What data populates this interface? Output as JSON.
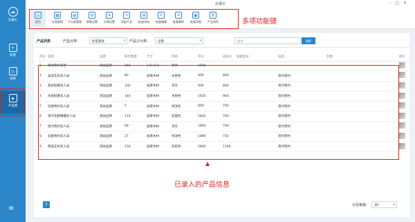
{
  "app": {
    "title": "云报价",
    "logo_label": "云报价"
  },
  "sidebar": {
    "items": [
      {
        "label": "新建",
        "icon": "new-icon"
      },
      {
        "label": "项目",
        "icon": "project-icon"
      },
      {
        "label": "产品库",
        "icon": "product-icon",
        "active": true
      }
    ]
  },
  "toolbar": {
    "items": [
      {
        "label": "首页"
      },
      {
        "label": "分类管理"
      },
      {
        "label": "子分类管理"
      },
      {
        "label": "参数设置"
      },
      {
        "label": "价格设置"
      },
      {
        "label": "添加产品"
      },
      {
        "label": "批量添加"
      },
      {
        "label": "批量编辑"
      },
      {
        "label": "批量删除"
      },
      {
        "label": "批量添图"
      },
      {
        "label": "产品排序"
      }
    ]
  },
  "annotations": {
    "toolbar": "多项功能键",
    "table": "已录入的产品信息",
    "arrow": "▲"
  },
  "filter": {
    "list_title": "产品列表",
    "category_label": "产品分类：",
    "category_value": "卧室家具",
    "subcategory_label": "产品子分类：",
    "subcategory_value": "全部",
    "search_placeholder": "搜索",
    "search_button": "搜索"
  },
  "table": {
    "headers": [
      "序号",
      "名称",
      "品牌",
      "库存数量",
      "尺寸",
      "风格",
      "单价",
      "成本价",
      "规格型号",
      "描述",
      "参数",
      "图片"
    ],
    "rows": [
      [
        "1",
        "现代简约衣柜",
        "测试品牌",
        "158",
        "1.8×2.0",
        "现代",
        "1500",
        "",
        "",
        "",
        "",
        ""
      ],
      [
        "2",
        "美式实木双人床",
        "测试品牌",
        "80",
        "加厚木材",
        "木原色",
        "900",
        "800",
        "",
        "现代简约",
        "",
        ""
      ],
      [
        "3",
        "意式轻奢双人床",
        "测试品牌",
        "100",
        "加厚木材",
        "深灰",
        "900",
        "800",
        "",
        "现代简约",
        "",
        ""
      ],
      [
        "4",
        "木质轻奢双人床",
        "测试品牌",
        "140",
        "加厚木材",
        "木原色",
        "1650",
        "900",
        "",
        "现代简约",
        "",
        ""
      ],
      [
        "5",
        "北欧简约双人床",
        "测试品牌",
        "5",
        "加厚木材",
        "纯净色",
        "800",
        "700",
        "",
        "现代简约",
        "",
        ""
      ],
      [
        "6",
        "现代北欧精雕双人床",
        "测试品牌",
        "119",
        "加厚木材",
        "双面色",
        "1840",
        "700",
        "",
        "现代简约",
        "",
        ""
      ],
      [
        "7",
        "现代简约双人床",
        "测试品牌",
        "68",
        "加厚木材",
        "深灰",
        "1860",
        "700",
        "",
        "现代简约",
        "",
        ""
      ],
      [
        "8",
        "北欧简约双人床",
        "测试品牌",
        "27",
        "加厚木材",
        "纯净色",
        "1890",
        "750",
        "",
        "现代简约",
        "",
        ""
      ],
      [
        "9",
        "简美实木双人床",
        "测试品牌",
        "150",
        "加厚木材",
        "灰棕色",
        "2890",
        "1190",
        "",
        "现代简约",
        "",
        ""
      ]
    ]
  },
  "pagination": {
    "current_page": "1",
    "page_size_label": "分页条数：",
    "page_size": "20"
  },
  "colors": {
    "accent": "#2a86c8",
    "annotation": "#e02020"
  }
}
